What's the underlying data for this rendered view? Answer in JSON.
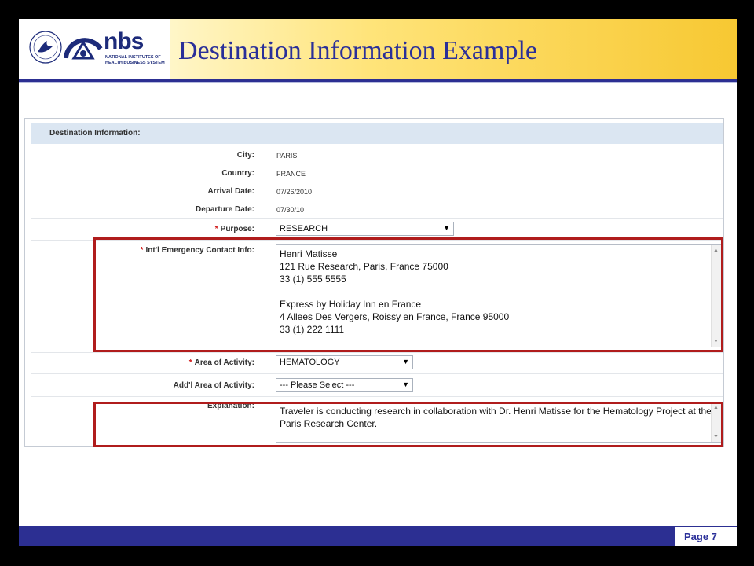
{
  "header": {
    "title": "Destination Information Example",
    "logo": {
      "mark": "nbs",
      "subtitle": "NATIONAL INSTITUTES OF HEALTH BUSINESS SYSTEM"
    }
  },
  "form": {
    "section_title": "Destination Information:",
    "fields": {
      "city": {
        "label": "City:",
        "value": "PARIS"
      },
      "country": {
        "label": "Country:",
        "value": "FRANCE"
      },
      "arrival": {
        "label": "Arrival Date:",
        "value": "07/26/2010"
      },
      "departure": {
        "label": "Departure Date:",
        "value": "07/30/10"
      },
      "purpose": {
        "label": "Purpose:",
        "value": "RESEARCH"
      },
      "emergency": {
        "label": "Int'l Emergency Contact Info:",
        "value": "Henri Matisse\n121 Rue Research, Paris, France 75000\n33 (1) 555 5555\n\nExpress by Holiday Inn en France\n4 Allees Des Vergers, Roissy en France, France 95000\n33 (1) 222 1111"
      },
      "area": {
        "label": "Area of Activity:",
        "value": "HEMATOLOGY"
      },
      "addl_area": {
        "label": "Add'l Area of Activity:",
        "value": "--- Please Select ---"
      },
      "explanation": {
        "label": "Explanation:",
        "value": "Traveler is conducting research in collaboration with Dr. Henri Matisse for the Hematology Project at the\nParis Research Center."
      }
    },
    "required_marker": "*"
  },
  "footer": {
    "page": "Page 7"
  },
  "colors": {
    "accent": "#2c2f92",
    "title": "#2a2f99",
    "highlight": "#b01c1c",
    "header_gold": "#f7c832"
  }
}
